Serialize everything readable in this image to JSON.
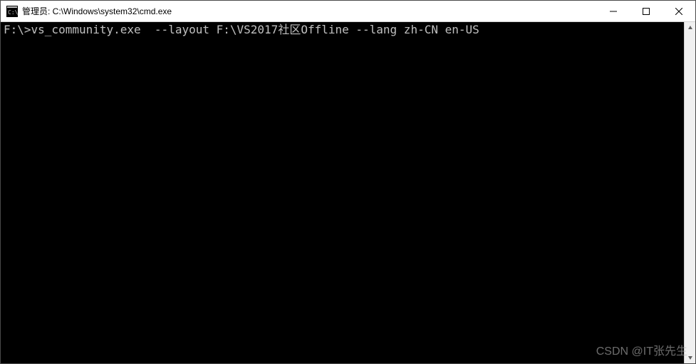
{
  "window": {
    "title": "管理员: C:\\Windows\\system32\\cmd.exe"
  },
  "terminal": {
    "lines": [
      {
        "prompt": "F:\\>",
        "command": "vs_community.exe  --layout F:\\VS2017社区Offline --lang zh-CN en-US"
      }
    ]
  },
  "watermark": "CSDN @IT张先生"
}
